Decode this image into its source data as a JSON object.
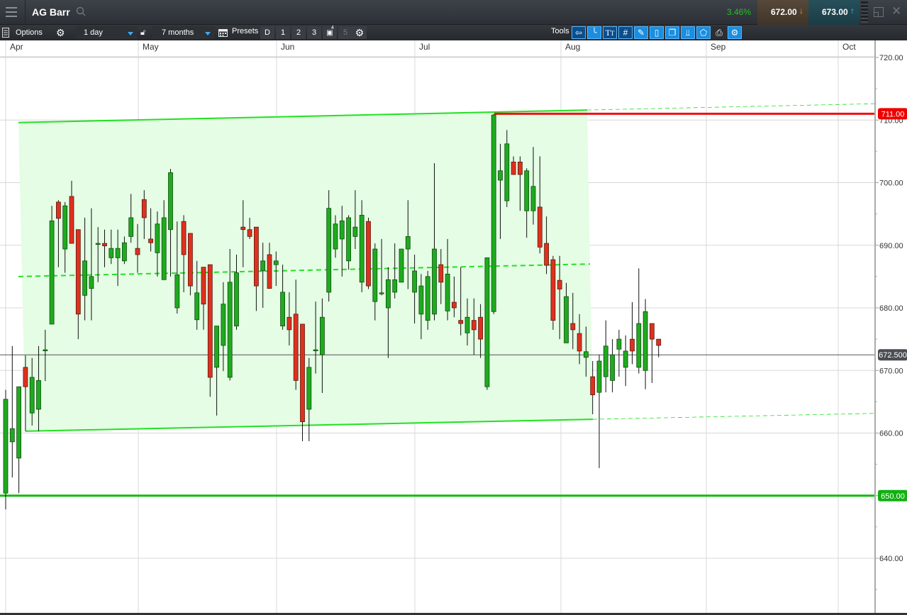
{
  "header": {
    "instrument": "AG Barr",
    "change_pct": "3.46%",
    "sell_price": "672.00",
    "buy_price": "673.00",
    "colors": {
      "change": "#22c322",
      "sell_arrow": "#f39c12",
      "buy_arrow": "#3fc1ff"
    }
  },
  "toolbar": {
    "options_label": "Options",
    "interval_value": "1 day",
    "range_value": "7 months",
    "presets_label": "Presets",
    "presets": [
      "D",
      "1",
      "2",
      "3",
      "4",
      "5"
    ],
    "tools_label": "Tools",
    "tools": [
      "back-arrow",
      "curve-line",
      "text",
      "grid",
      "draw-pencil",
      "candle",
      "layers",
      "indicators",
      "tag",
      "print",
      "settings-edit"
    ]
  },
  "chart_data": {
    "type": "candlestick",
    "x_ticks": [
      "Apr",
      "May",
      "Jun",
      "Jul",
      "Aug",
      "Sep",
      "Oct"
    ],
    "y_ticks": [
      "720.00",
      "710.00",
      "700.00",
      "690.00",
      "680.00",
      "670.00",
      "660.00",
      "650.00",
      "640.00"
    ],
    "ylim": [
      633,
      722.7
    ],
    "grid": true,
    "colors": {
      "up": "#1faa1f",
      "down": "#e0301e",
      "channel": "#22e022",
      "resistance": "#ee1111",
      "support": "#11bb11"
    },
    "candles_ohlc": [
      [
        650.4,
        666.9,
        647.8,
        665.4
      ],
      [
        658.6,
        673.9,
        652.9,
        660.7
      ],
      [
        656.0,
        667.4,
        650.4,
        667.4
      ],
      [
        670.5,
        672.4,
        660.3,
        667.4
      ],
      [
        663.2,
        672.0,
        661.2,
        668.9
      ],
      [
        663.8,
        673.9,
        660.3,
        668.4
      ],
      [
        673.3,
        676.5,
        668.3,
        673.3
      ],
      [
        677.4,
        696.3,
        677.4,
        693.9
      ],
      [
        696.9,
        697.2,
        686.5,
        694.3
      ],
      [
        689.4,
        696.9,
        685.6,
        696.3
      ],
      [
        697.8,
        700.3,
        690.3,
        690.3
      ],
      [
        692.5,
        692.5,
        675.0,
        679.0
      ],
      [
        682.0,
        694.4,
        678.0,
        687.5
      ],
      [
        683.1,
        695.9,
        678.0,
        685.0
      ],
      [
        690.3,
        692.9,
        684.1,
        690.3
      ],
      [
        690.3,
        692.5,
        686.5,
        689.9
      ],
      [
        688.0,
        692.5,
        687.0,
        689.5
      ],
      [
        688.0,
        692.5,
        683.5,
        689.5
      ],
      [
        687.5,
        691.4,
        687.0,
        690.4
      ],
      [
        691.4,
        698.2,
        690.4,
        694.4
      ],
      [
        689.5,
        693.4,
        685.6,
        688.5
      ],
      [
        697.3,
        698.8,
        691.0,
        694.4
      ],
      [
        691.0,
        695.9,
        689.0,
        690.4
      ],
      [
        688.8,
        695.4,
        685.0,
        693.4
      ],
      [
        684.5,
        697.2,
        684.5,
        694.4
      ],
      [
        692.5,
        702.2,
        685.0,
        701.6
      ],
      [
        680.0,
        693.8,
        679.1,
        685.3
      ],
      [
        693.8,
        694.8,
        682.5,
        688.5
      ],
      [
        691.9,
        691.9,
        682.0,
        683.5
      ],
      [
        678.1,
        687.5,
        676.5,
        682.4
      ],
      [
        686.5,
        686.5,
        676.5,
        680.6
      ],
      [
        686.9,
        686.9,
        665.8,
        668.9
      ],
      [
        670.5,
        677.1,
        662.8,
        677.1
      ],
      [
        674.0,
        684.1,
        669.9,
        680.6
      ],
      [
        668.9,
        689.4,
        668.4,
        684.1
      ],
      [
        677.1,
        688.5,
        676.5,
        685.6
      ],
      [
        692.9,
        697.2,
        686.5,
        692.5
      ],
      [
        692.5,
        694.4,
        691.0,
        691.4
      ],
      [
        692.9,
        692.9,
        679.5,
        683.5
      ],
      [
        685.9,
        690.4,
        680.0,
        687.5
      ],
      [
        688.5,
        690.4,
        683.1,
        683.1
      ],
      [
        686.9,
        689.0,
        683.5,
        687.5
      ],
      [
        677.1,
        686.9,
        676.5,
        682.5
      ],
      [
        678.5,
        682.5,
        674.0,
        676.5
      ],
      [
        679.0,
        684.5,
        666.9,
        668.4
      ],
      [
        677.4,
        677.4,
        658.7,
        661.8
      ],
      [
        663.8,
        672.0,
        658.7,
        670.5
      ],
      [
        673.3,
        681.0,
        669.5,
        673.3
      ],
      [
        672.5,
        681.5,
        666.4,
        678.5
      ],
      [
        682.5,
        698.8,
        681.0,
        695.9
      ],
      [
        689.4,
        694.8,
        688.0,
        693.4
      ],
      [
        691.0,
        696.3,
        685.0,
        693.9
      ],
      [
        687.5,
        694.8,
        686.1,
        694.4
      ],
      [
        691.4,
        698.8,
        689.4,
        692.9
      ],
      [
        684.1,
        697.2,
        682.5,
        694.8
      ],
      [
        693.8,
        694.4,
        683.0,
        683.5
      ],
      [
        681.0,
        690.3,
        678.0,
        689.4
      ],
      [
        682.4,
        691.0,
        682.0,
        682.4
      ],
      [
        680.0,
        686.5,
        672.0,
        684.5
      ],
      [
        682.5,
        690.3,
        681.5,
        684.5
      ],
      [
        684.1,
        689.4,
        684.1,
        689.4
      ],
      [
        689.4,
        697.2,
        683.0,
        691.4
      ],
      [
        682.5,
        688.5,
        677.5,
        685.9
      ],
      [
        679.0,
        685.4,
        675.0,
        683.5
      ],
      [
        678.0,
        685.9,
        676.5,
        685.0
      ],
      [
        679.0,
        703.1,
        678.0,
        689.4
      ],
      [
        686.9,
        689.4,
        680.6,
        684.1
      ],
      [
        679.5,
        691.0,
        678.0,
        685.4
      ],
      [
        680.9,
        685.0,
        678.5,
        680.0
      ],
      [
        678.0,
        686.5,
        675.6,
        677.5
      ],
      [
        676.0,
        681.5,
        674.0,
        678.5
      ],
      [
        678.0,
        681.5,
        672.5,
        676.5
      ],
      [
        678.5,
        680.6,
        672.0,
        675.0
      ],
      [
        667.4,
        688.0,
        666.9,
        688.0
      ],
      [
        679.4,
        711.0,
        679.0,
        710.8
      ],
      [
        700.4,
        706.2,
        691.0,
        701.9
      ],
      [
        697.1,
        708.4,
        696.1,
        706.2
      ],
      [
        703.3,
        704.2,
        701.3,
        701.3
      ],
      [
        703.3,
        704.2,
        695.5,
        701.3
      ],
      [
        695.5,
        702.3,
        691.2,
        701.9
      ],
      [
        695.5,
        705.7,
        693.3,
        699.4
      ],
      [
        696.1,
        704.2,
        688.7,
        689.7
      ],
      [
        690.3,
        694.6,
        685.4,
        686.8
      ],
      [
        687.7,
        688.3,
        676.5,
        678.0
      ],
      [
        684.4,
        688.3,
        675.0,
        683.0
      ],
      [
        674.4,
        684.0,
        674.4,
        681.8
      ],
      [
        677.5,
        682.4,
        673.4,
        676.5
      ],
      [
        675.9,
        679.0,
        671.0,
        673.1
      ],
      [
        672.1,
        677.0,
        669.0,
        673.0
      ],
      [
        669.0,
        671.5,
        663.0,
        666.1
      ],
      [
        666.5,
        672.5,
        654.4,
        671.5
      ],
      [
        669.0,
        678.0,
        666.5,
        673.9
      ],
      [
        668.4,
        675.0,
        666.5,
        672.5
      ],
      [
        673.4,
        676.5,
        669.0,
        675.0
      ],
      [
        670.5,
        675.6,
        667.5,
        673.1
      ],
      [
        675.0,
        680.9,
        671.0,
        673.1
      ],
      [
        670.5,
        686.3,
        669.5,
        677.5
      ],
      [
        670.0,
        681.4,
        667.0,
        679.4
      ],
      [
        677.5,
        677.5,
        668.0,
        675.0
      ],
      [
        675.0,
        675.0,
        672.1,
        674.0
      ]
    ],
    "annotations": {
      "channel_upper": [
        709.6,
        711.6
      ],
      "channel_middle": [
        685.0,
        687.0
      ],
      "channel_lower": [
        660.3,
        662.2
      ],
      "resistance_label": "711.00",
      "support_label": "650.00",
      "current_price_label": "672.500",
      "resistance": 711.0,
      "support": 650.0,
      "current_price": 672.5
    }
  }
}
